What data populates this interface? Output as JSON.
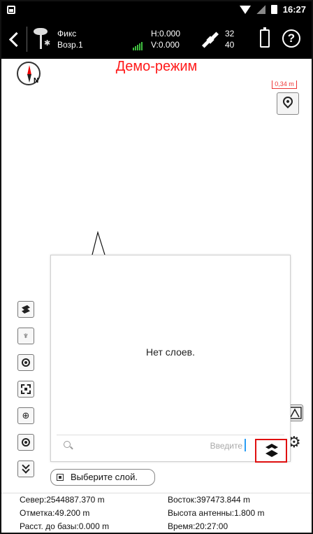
{
  "status_bar": {
    "time": "16:27"
  },
  "toolbar": {
    "solution_status": "Фикс",
    "solution_mode": "Возр.1",
    "h_precision": "H:0.000",
    "v_precision": "V:0.000",
    "sats_used": "32",
    "sats_visible": "40",
    "help_label": "?"
  },
  "map": {
    "demo_mode_label": "Демо-режим",
    "compass_letter": "N",
    "scale_label": "0,34 m"
  },
  "layers_panel": {
    "empty_message": "Нет слоев.",
    "search_placeholder": "Введите"
  },
  "choose_layer_label": "Выберите слой.",
  "info": {
    "north": "Север:2544887.370 m",
    "east": "Восток:397473.844 m",
    "elevation": "Отметка:49.200 m",
    "antenna_height": "Высота антенны:1.800 m",
    "base_distance": "Расст. до базы:0.000 m",
    "time": "Время:20:27:00"
  },
  "colors": {
    "demo_text": "#ff1a1a",
    "highlight_border": "#e01010",
    "signal_bars": "#3fbf3f",
    "toolbar_bg": "#000000"
  },
  "icons": [
    "back-icon",
    "rover-icon",
    "bluetooth-icon",
    "signal-icon",
    "satellite-icon",
    "battery-icon",
    "help-icon",
    "compass-icon",
    "locate-icon",
    "layers-icon",
    "gear-icon",
    "search-icon"
  ]
}
